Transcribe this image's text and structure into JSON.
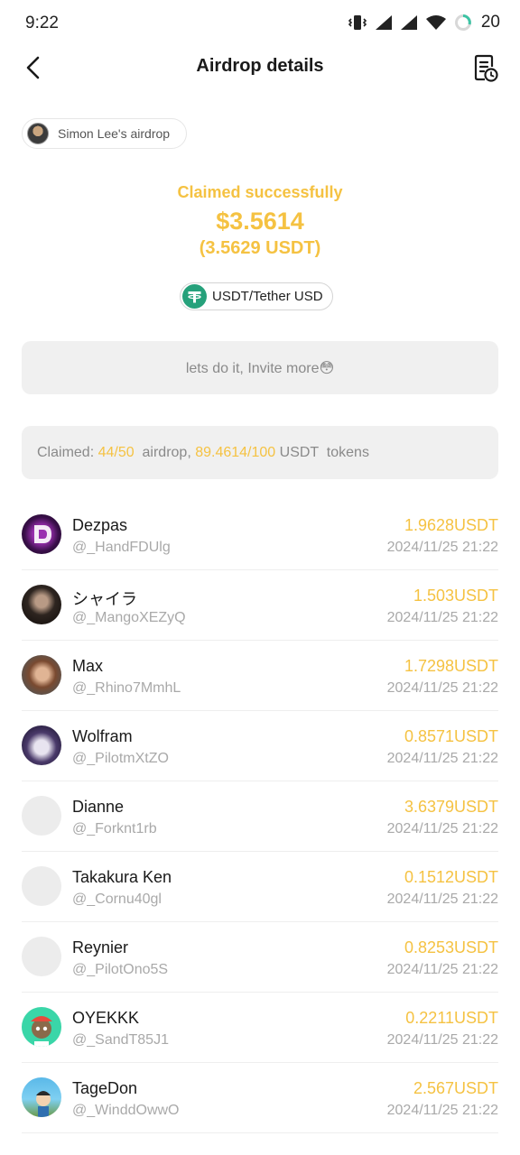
{
  "status_bar": {
    "time": "9:22",
    "battery": "20"
  },
  "nav": {
    "title": "Airdrop details",
    "back_icon": "chevron-left-icon",
    "history_icon": "receipt-clock-icon"
  },
  "sender": {
    "label": "Simon Lee's airdrop"
  },
  "claim": {
    "status": "Claimed successfully",
    "amount_usd": "$3.5614",
    "amount_token": "(3.5629 USDT)"
  },
  "token": {
    "label": "USDT/Tether USD",
    "icon": "tether-icon",
    "color": "#26a17b"
  },
  "message": "lets do it, Invite more😳",
  "summary": {
    "prefix": "Claimed: ",
    "claimed_count": "44/50",
    "middle": "  airdrop, ",
    "claimed_amount": "89.4614/100",
    "suffix": " USDT  tokens"
  },
  "colors": {
    "accent": "#f5c242",
    "muted": "#a9a9a9",
    "box_bg": "#f0f0f0"
  },
  "claims": [
    {
      "name": "Dezpas",
      "handle": "@_HandFDUlg",
      "amount": "1.9628USDT",
      "time": "2024/11/25 21:22",
      "avatar": "dezpas-logo"
    },
    {
      "name": "シャイラ",
      "handle": "@_MangoXEZyQ",
      "amount": "1.503USDT",
      "time": "2024/11/25 21:22",
      "avatar": "photo"
    },
    {
      "name": "Max",
      "handle": "@_Rhino7MmhL",
      "amount": "1.7298USDT",
      "time": "2024/11/25 21:22",
      "avatar": "photo"
    },
    {
      "name": "Wolfram",
      "handle": "@_PilotmXtZO",
      "amount": "0.8571USDT",
      "time": "2024/11/25 21:22",
      "avatar": "photo"
    },
    {
      "name": "Dianne",
      "handle": "@_Forknt1rb",
      "amount": "3.6379USDT",
      "time": "2024/11/25 21:22",
      "avatar": "placeholder"
    },
    {
      "name": "Takakura Ken",
      "handle": "@_Cornu40gl",
      "amount": "0.1512USDT",
      "time": "2024/11/25 21:22",
      "avatar": "placeholder"
    },
    {
      "name": "Reynier",
      "handle": "@_PilotOno5S",
      "amount": "0.8253USDT",
      "time": "2024/11/25 21:22",
      "avatar": "placeholder"
    },
    {
      "name": "OYEKKK",
      "handle": "@_SandT85J1",
      "amount": "0.2211USDT",
      "time": "2024/11/25 21:22",
      "avatar": "ape-nft"
    },
    {
      "name": "TageDon",
      "handle": "@_WinddOwwO",
      "amount": "2.567USDT",
      "time": "2024/11/25 21:22",
      "avatar": "cartoon"
    }
  ]
}
